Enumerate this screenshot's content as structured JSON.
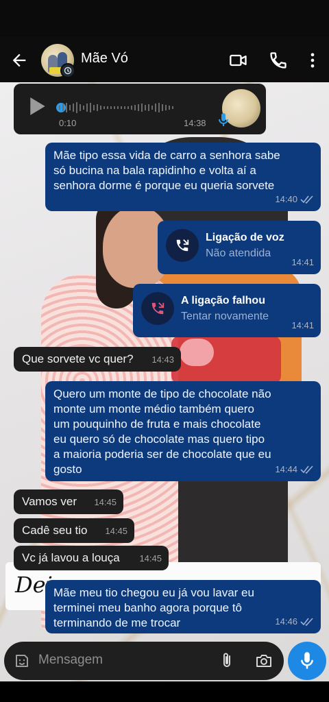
{
  "header": {
    "contact_name": "Mãe Vó",
    "icons": [
      "back-arrow-icon",
      "video-call-icon",
      "phone-icon",
      "more-vert-icon"
    ]
  },
  "voice_message": {
    "duration": "0:10",
    "time": "14:38"
  },
  "messages": [
    {
      "dir": "out",
      "text_lines": [
        "Mãe tipo essa vida de carro a senhora sabe",
        "só bucina na bala rapidinho e volta aí a",
        "senhora dorme é porque eu queria sorvete"
      ],
      "time": "14:40"
    },
    {
      "dir": "out",
      "type": "call",
      "title": "Ligação de voz",
      "subtitle": "Não atendida",
      "time": "14:41",
      "icon": "missed-call-icon"
    },
    {
      "dir": "out",
      "type": "call",
      "title": "A ligação falhou",
      "subtitle": "Tentar novamente",
      "time": "14:41",
      "icon": "failed-call-icon"
    },
    {
      "dir": "in",
      "text": "Que sorvete vc quer?",
      "time": "14:43"
    },
    {
      "dir": "out",
      "text_lines": [
        "Quero um monte de tipo de chocolate não",
        "monte um monte médio também quero",
        "um pouquinho de fruta e mais chocolate",
        "eu quero só de chocolate mas quero tipo",
        "a maioria poderia ser de chocolate que eu",
        "gosto"
      ],
      "time": "14:44"
    },
    {
      "dir": "in",
      "text": "Vamos ver",
      "time": "14:45"
    },
    {
      "dir": "in",
      "text": "Cadê seu tio",
      "time": "14:45"
    },
    {
      "dir": "in",
      "text": "Vc já lavou a louça",
      "time": "14:45"
    },
    {
      "dir": "out",
      "text_lines": [
        "Mãe meu tio chegou eu já vou lavar eu",
        "terminei meu banho agora porque tô",
        "terminando de me trocar"
      ],
      "time": "14:46"
    }
  ],
  "background_card_text": "Dei",
  "composer": {
    "placeholder": "Mensagem",
    "icons": [
      "sticker-icon",
      "attach-icon",
      "camera-icon",
      "mic-icon"
    ]
  },
  "colors": {
    "outgoing_bubble": "#0c3a7c",
    "incoming_bubble": "#1f1f1f",
    "mic_button": "#1e88e5"
  }
}
